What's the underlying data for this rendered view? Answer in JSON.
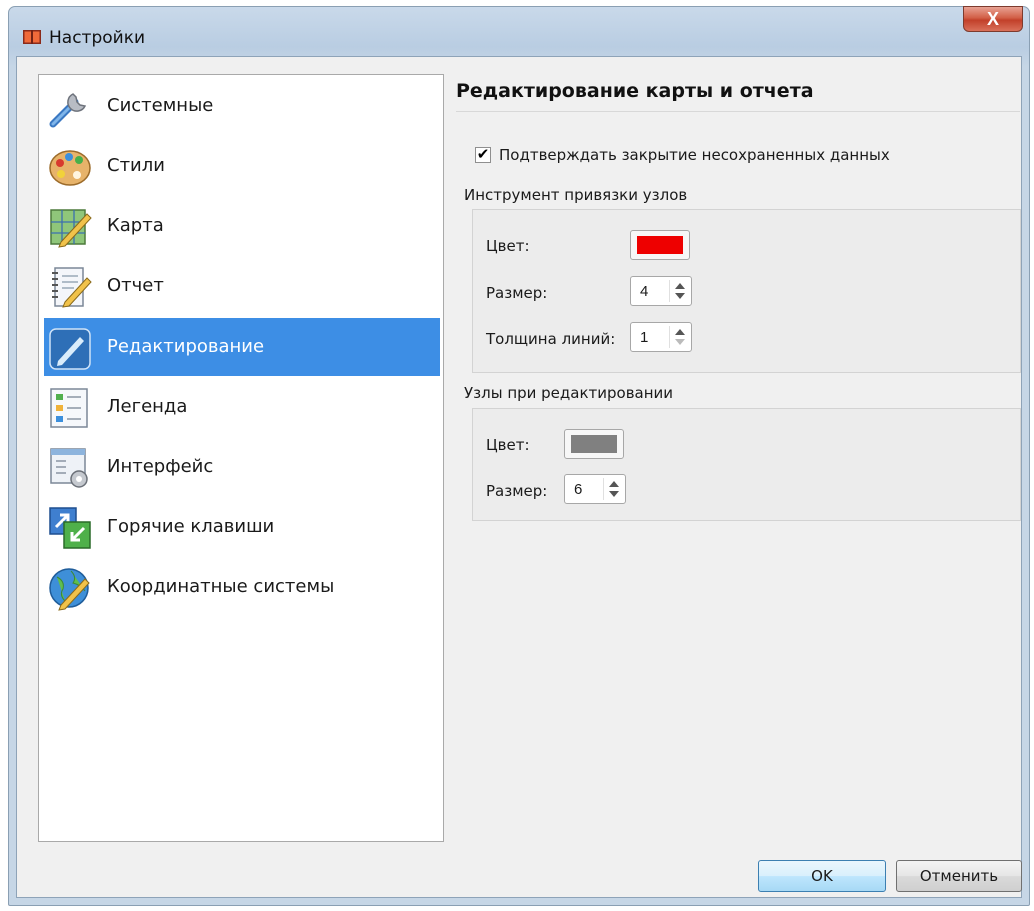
{
  "window": {
    "title": "Настройки",
    "close_glyph": "X"
  },
  "sidebar": {
    "items": [
      {
        "label": "Системные",
        "icon": "wrench-icon"
      },
      {
        "label": "Стили",
        "icon": "palette-icon"
      },
      {
        "label": "Карта",
        "icon": "map-edit-icon"
      },
      {
        "label": "Отчет",
        "icon": "notebook-icon"
      },
      {
        "label": "Редактирование",
        "icon": "pencil-icon",
        "selected": true
      },
      {
        "label": "Легенда",
        "icon": "legend-icon"
      },
      {
        "label": "Интерфейс",
        "icon": "interface-settings-icon"
      },
      {
        "label": "Горячие клавиши",
        "icon": "shortcut-icon"
      },
      {
        "label": "Координатные системы",
        "icon": "globe-icon"
      }
    ]
  },
  "panel": {
    "title": "Редактирование карты и отчета",
    "confirm_checkbox": {
      "label": "Подтверждать закрытие несохраненных данных",
      "checked": true,
      "mark": "✔"
    },
    "snap_tool": {
      "title": "Инструмент привязки узлов",
      "color_label": "Цвет:",
      "color_value": "#ee0000",
      "size_label": "Размер:",
      "size_value": "4",
      "width_label": "Толщина линий:",
      "width_value": "1"
    },
    "edit_nodes": {
      "title": "Узлы при редактировании",
      "color_label": "Цвет:",
      "color_value": "#808080",
      "size_label": "Размер:",
      "size_value": "6"
    }
  },
  "buttons": {
    "ok": "OK",
    "cancel": "Отменить"
  },
  "colors": {
    "selection": "#3d8ee5",
    "window_frame": "#b9cde2",
    "close_button": "#c2402a"
  }
}
